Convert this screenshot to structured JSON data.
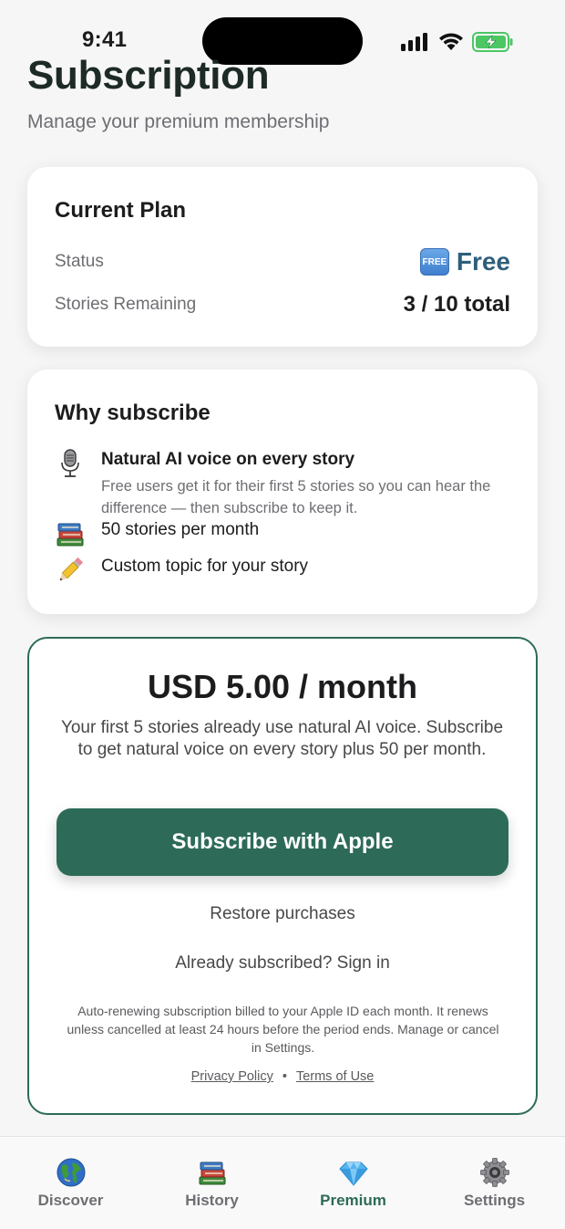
{
  "status_bar": {
    "time": "9:41"
  },
  "header": {
    "title": "Subscription",
    "subtitle": "Manage your premium membership"
  },
  "current_plan": {
    "title": "Current Plan",
    "status_label": "Status",
    "status_badge": "FREE",
    "status_value": "Free",
    "remaining_label": "Stories Remaining",
    "remaining_value": "3 / 10 total"
  },
  "why_subscribe": {
    "title": "Why subscribe",
    "benefits": [
      {
        "icon": "microphone-icon",
        "title": "Natural AI voice on every story",
        "description": "Free users get it for their first 5 stories so you can hear the difference — then subscribe to keep it."
      },
      {
        "icon": "books-icon",
        "title": "50 stories per month"
      },
      {
        "icon": "pencil-icon",
        "title": "Custom topic for your story"
      }
    ]
  },
  "pricing": {
    "price": "USD 5.00 / month",
    "description": "Your first 5 stories already use natural AI voice. Subscribe to get natural voice on every story plus 50 per month.",
    "subscribe_label": "Subscribe with Apple",
    "restore_label": "Restore purchases",
    "signin_label": "Already subscribed? Sign in",
    "legal_text": "Auto-renewing subscription billed to your Apple ID each month. It renews unless cancelled at least 24 hours before the period ends. Manage or cancel in Settings.",
    "privacy_label": "Privacy Policy",
    "separator": "•",
    "terms_label": "Terms of Use"
  },
  "tabs": [
    {
      "label": "Discover",
      "icon": "globe-icon",
      "active": false
    },
    {
      "label": "History",
      "icon": "books-icon",
      "active": false
    },
    {
      "label": "Premium",
      "icon": "diamond-icon",
      "active": true
    },
    {
      "label": "Settings",
      "icon": "gear-icon",
      "active": false
    }
  ],
  "colors": {
    "accent": "#2d6b58",
    "status_free": "#2e5f7c",
    "background": "#f6f6f7"
  }
}
